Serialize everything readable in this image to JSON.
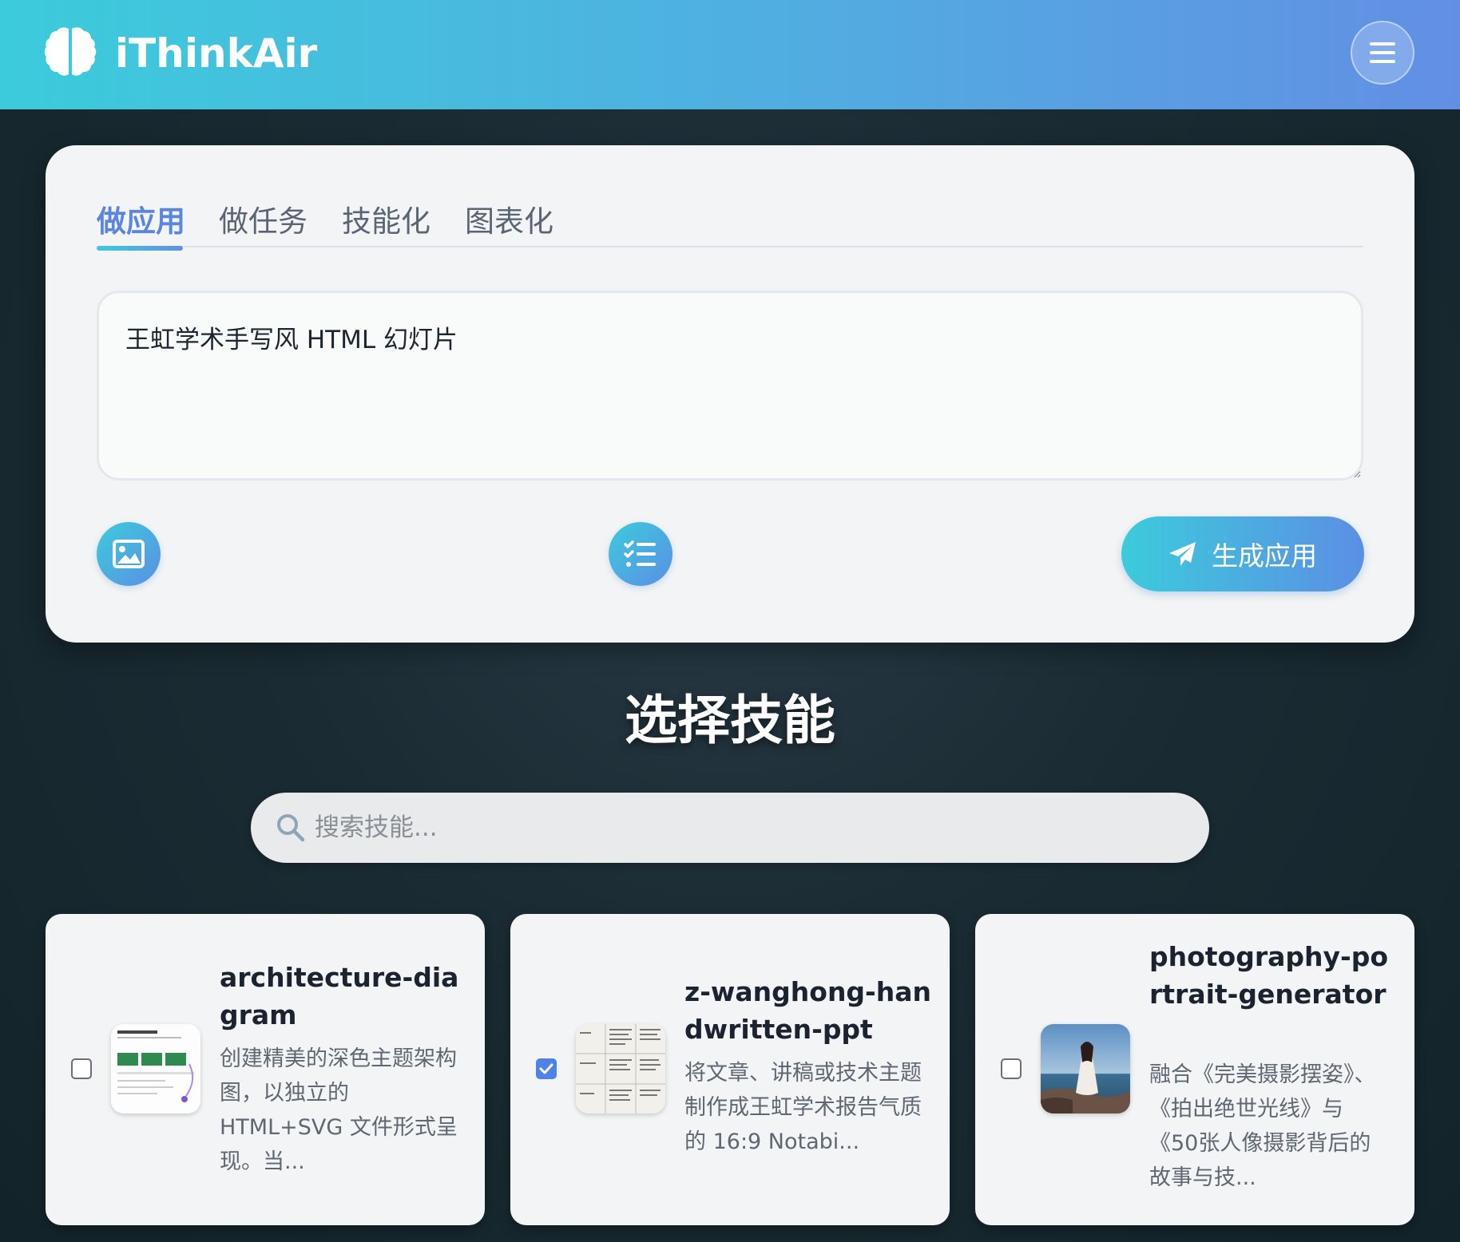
{
  "app": {
    "title": "iThinkAir"
  },
  "header": {
    "logo_icon": "brain-icon",
    "menu_icon": "hamburger-menu-icon"
  },
  "tabs": [
    {
      "label": "做应用",
      "active": true
    },
    {
      "label": "做任务",
      "active": false
    },
    {
      "label": "技能化",
      "active": false
    },
    {
      "label": "图表化",
      "active": false
    }
  ],
  "prompt": {
    "value": "王虹学术手写风 HTML 幻灯片"
  },
  "actions": {
    "image_icon": "image-icon",
    "tasks_icon": "task-list-icon",
    "generate_label": "生成应用",
    "generate_icon": "paper-plane-icon"
  },
  "skills_section": {
    "title": "选择技能",
    "search_placeholder": "搜索技能..."
  },
  "skills": [
    {
      "name": "architecture-diagram",
      "description": "创建精美的深色主题架构图，以独立的 HTML+SVG 文件形式呈现。当...",
      "checked": false
    },
    {
      "name": "z-wanghong-handwritten-ppt",
      "description": "将文章、讲稿或技术主题制作成王虹学术报告气质的 16:9 Notabi...",
      "checked": true
    },
    {
      "name": "photography-portrait-generator",
      "description": "融合《完美摄影摆姿》、《拍出绝世光线》与《50张人像摄影背后的故事与技...",
      "checked": false
    }
  ],
  "colors": {
    "accent": "#5b86e0",
    "header_gradient_start": "#3ccbdc",
    "header_gradient_end": "#628fe4",
    "checkbox_checked": "#4f82e6"
  }
}
